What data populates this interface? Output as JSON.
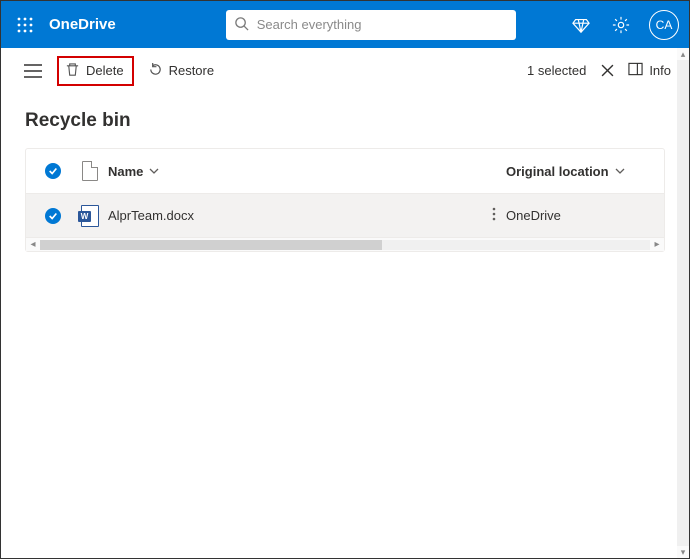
{
  "header": {
    "brand": "OneDrive",
    "search_placeholder": "Search everything",
    "avatar_initials": "CA"
  },
  "cmdbar": {
    "delete_label": "Delete",
    "restore_label": "Restore",
    "selected_label": "1 selected",
    "info_label": "Info"
  },
  "page": {
    "title": "Recycle bin"
  },
  "columns": {
    "name": "Name",
    "original_location": "Original location"
  },
  "rows": [
    {
      "name": "AlprTeam.docx",
      "original_location": "OneDrive",
      "file_icon_letter": "W"
    }
  ]
}
